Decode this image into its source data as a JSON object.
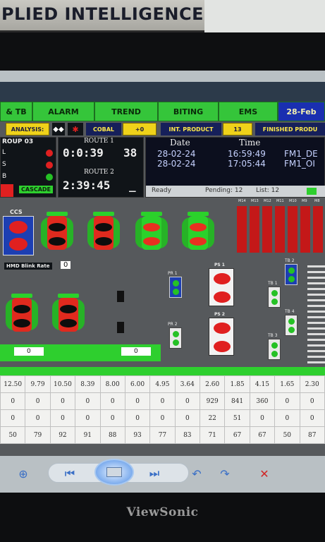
{
  "sign": {
    "text": "PLIED INTELLIGENCE"
  },
  "brand": "ViewSonic",
  "nav_tabs": [
    "& TB",
    "ALARM",
    "TREND",
    "BITING",
    "EMS",
    "28-Feb"
  ],
  "toolbar": {
    "analysis_label": "ANALYSIS:",
    "cobal_label": "COBAL",
    "cobal_value": "+0",
    "int_product_label": "INT. PRODUCT",
    "int_product_value": "13",
    "finished_label": "FINISHED PRODU"
  },
  "group": {
    "title": "ROUP 03",
    "items": [
      "L",
      "S",
      "B"
    ],
    "cascade_label": "CASCADE"
  },
  "routes": {
    "route1_label": "ROUTE 1",
    "route1_time": "0:0:39",
    "route1_count": "38",
    "route2_label": "ROUTE 2",
    "route2_time": "2:39:45",
    "route2_suffix": "_"
  },
  "log": {
    "headers": [
      "Date",
      "Time"
    ],
    "rows": [
      {
        "date": "28-02-24",
        "time": "16:59:49",
        "code": "FM1_DE"
      },
      {
        "date": "28-02-24",
        "time": "17:05:44",
        "code": "FM1_OI"
      }
    ],
    "status": "Ready",
    "pending": "Pending: 12",
    "list": "List: 12"
  },
  "ccs_label": "CCS",
  "hmd_label": "HMD Blink Rate",
  "hmd_value": "0",
  "silo_labels": [
    "M14",
    "M13",
    "M12",
    "M11",
    "M10",
    "M9",
    "M8"
  ],
  "station_labels": [
    "PR 1",
    "PR 2",
    "PS 1",
    "PS 2",
    "TB 1",
    "TB 2",
    "TB 3",
    "TB 4"
  ],
  "counter_values": [
    "0",
    "0"
  ],
  "table": {
    "rows": [
      [
        "12.50",
        "9.79",
        "10.50",
        "8.39",
        "8.00",
        "6.00",
        "4.95",
        "3.64",
        "2.60",
        "1.85",
        "4.15",
        "1.65",
        "2.30"
      ],
      [
        "0",
        "0",
        "0",
        "0",
        "0",
        "0",
        "0",
        "0",
        "929",
        "841",
        "360",
        "0",
        "0"
      ],
      [
        "0",
        "0",
        "0",
        "0",
        "0",
        "0",
        "0",
        "0",
        "22",
        "51",
        "0",
        "0",
        "0"
      ],
      [
        "50",
        "79",
        "92",
        "91",
        "88",
        "93",
        "77",
        "83",
        "71",
        "67",
        "67",
        "50",
        "87"
      ]
    ]
  },
  "colors": {
    "tab_green": "#35c53a",
    "date_tab": "#1a2fb0",
    "alarm_red": "#e02020",
    "ok_green": "#25c125"
  },
  "media_icons": [
    "fit-icon",
    "previous-icon",
    "slideshow-icon",
    "next-icon",
    "rotate-ccw-icon",
    "rotate-cw-icon",
    "delete-icon"
  ]
}
